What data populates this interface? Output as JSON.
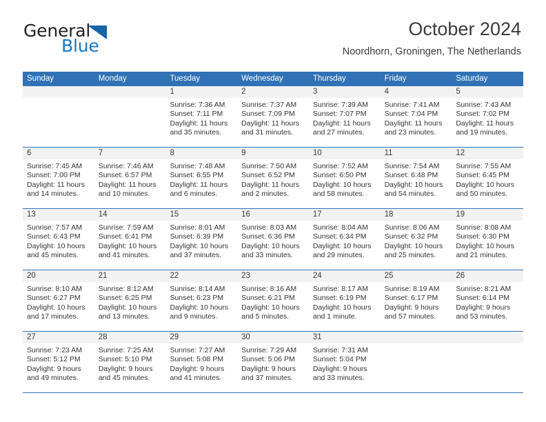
{
  "brand": {
    "line1": "General",
    "line2": "Blue",
    "triangle_color": "#1565a8",
    "blue_text_color": "#1577c4"
  },
  "header": {
    "title": "October 2024",
    "subtitle": "Noordhorn, Groningen, The Netherlands"
  },
  "colors": {
    "header_blue": "#3072b5",
    "day_number_band": "#f2f2f2",
    "text": "#333333"
  },
  "calendar": {
    "weekday_headers": [
      "Sunday",
      "Monday",
      "Tuesday",
      "Wednesday",
      "Thursday",
      "Friday",
      "Saturday"
    ],
    "weeks": [
      [
        {
          "day": "",
          "empty": true
        },
        {
          "day": "",
          "empty": true
        },
        {
          "day": "1",
          "sunrise": "Sunrise: 7:36 AM",
          "sunset": "Sunset: 7:11 PM",
          "daylight_1": "Daylight: 11 hours",
          "daylight_2": "and 35 minutes."
        },
        {
          "day": "2",
          "sunrise": "Sunrise: 7:37 AM",
          "sunset": "Sunset: 7:09 PM",
          "daylight_1": "Daylight: 11 hours",
          "daylight_2": "and 31 minutes."
        },
        {
          "day": "3",
          "sunrise": "Sunrise: 7:39 AM",
          "sunset": "Sunset: 7:07 PM",
          "daylight_1": "Daylight: 11 hours",
          "daylight_2": "and 27 minutes."
        },
        {
          "day": "4",
          "sunrise": "Sunrise: 7:41 AM",
          "sunset": "Sunset: 7:04 PM",
          "daylight_1": "Daylight: 11 hours",
          "daylight_2": "and 23 minutes."
        },
        {
          "day": "5",
          "sunrise": "Sunrise: 7:43 AM",
          "sunset": "Sunset: 7:02 PM",
          "daylight_1": "Daylight: 11 hours",
          "daylight_2": "and 19 minutes."
        }
      ],
      [
        {
          "day": "6",
          "sunrise": "Sunrise: 7:45 AM",
          "sunset": "Sunset: 7:00 PM",
          "daylight_1": "Daylight: 11 hours",
          "daylight_2": "and 14 minutes."
        },
        {
          "day": "7",
          "sunrise": "Sunrise: 7:46 AM",
          "sunset": "Sunset: 6:57 PM",
          "daylight_1": "Daylight: 11 hours",
          "daylight_2": "and 10 minutes."
        },
        {
          "day": "8",
          "sunrise": "Sunrise: 7:48 AM",
          "sunset": "Sunset: 6:55 PM",
          "daylight_1": "Daylight: 11 hours",
          "daylight_2": "and 6 minutes."
        },
        {
          "day": "9",
          "sunrise": "Sunrise: 7:50 AM",
          "sunset": "Sunset: 6:52 PM",
          "daylight_1": "Daylight: 11 hours",
          "daylight_2": "and 2 minutes."
        },
        {
          "day": "10",
          "sunrise": "Sunrise: 7:52 AM",
          "sunset": "Sunset: 6:50 PM",
          "daylight_1": "Daylight: 10 hours",
          "daylight_2": "and 58 minutes."
        },
        {
          "day": "11",
          "sunrise": "Sunrise: 7:54 AM",
          "sunset": "Sunset: 6:48 PM",
          "daylight_1": "Daylight: 10 hours",
          "daylight_2": "and 54 minutes."
        },
        {
          "day": "12",
          "sunrise": "Sunrise: 7:55 AM",
          "sunset": "Sunset: 6:45 PM",
          "daylight_1": "Daylight: 10 hours",
          "daylight_2": "and 50 minutes."
        }
      ],
      [
        {
          "day": "13",
          "sunrise": "Sunrise: 7:57 AM",
          "sunset": "Sunset: 6:43 PM",
          "daylight_1": "Daylight: 10 hours",
          "daylight_2": "and 45 minutes."
        },
        {
          "day": "14",
          "sunrise": "Sunrise: 7:59 AM",
          "sunset": "Sunset: 6:41 PM",
          "daylight_1": "Daylight: 10 hours",
          "daylight_2": "and 41 minutes."
        },
        {
          "day": "15",
          "sunrise": "Sunrise: 8:01 AM",
          "sunset": "Sunset: 6:39 PM",
          "daylight_1": "Daylight: 10 hours",
          "daylight_2": "and 37 minutes."
        },
        {
          "day": "16",
          "sunrise": "Sunrise: 8:03 AM",
          "sunset": "Sunset: 6:36 PM",
          "daylight_1": "Daylight: 10 hours",
          "daylight_2": "and 33 minutes."
        },
        {
          "day": "17",
          "sunrise": "Sunrise: 8:04 AM",
          "sunset": "Sunset: 6:34 PM",
          "daylight_1": "Daylight: 10 hours",
          "daylight_2": "and 29 minutes."
        },
        {
          "day": "18",
          "sunrise": "Sunrise: 8:06 AM",
          "sunset": "Sunset: 6:32 PM",
          "daylight_1": "Daylight: 10 hours",
          "daylight_2": "and 25 minutes."
        },
        {
          "day": "19",
          "sunrise": "Sunrise: 8:08 AM",
          "sunset": "Sunset: 6:30 PM",
          "daylight_1": "Daylight: 10 hours",
          "daylight_2": "and 21 minutes."
        }
      ],
      [
        {
          "day": "20",
          "sunrise": "Sunrise: 8:10 AM",
          "sunset": "Sunset: 6:27 PM",
          "daylight_1": "Daylight: 10 hours",
          "daylight_2": "and 17 minutes."
        },
        {
          "day": "21",
          "sunrise": "Sunrise: 8:12 AM",
          "sunset": "Sunset: 6:25 PM",
          "daylight_1": "Daylight: 10 hours",
          "daylight_2": "and 13 minutes."
        },
        {
          "day": "22",
          "sunrise": "Sunrise: 8:14 AM",
          "sunset": "Sunset: 6:23 PM",
          "daylight_1": "Daylight: 10 hours",
          "daylight_2": "and 9 minutes."
        },
        {
          "day": "23",
          "sunrise": "Sunrise: 8:16 AM",
          "sunset": "Sunset: 6:21 PM",
          "daylight_1": "Daylight: 10 hours",
          "daylight_2": "and 5 minutes."
        },
        {
          "day": "24",
          "sunrise": "Sunrise: 8:17 AM",
          "sunset": "Sunset: 6:19 PM",
          "daylight_1": "Daylight: 10 hours",
          "daylight_2": "and 1 minute."
        },
        {
          "day": "25",
          "sunrise": "Sunrise: 8:19 AM",
          "sunset": "Sunset: 6:17 PM",
          "daylight_1": "Daylight: 9 hours",
          "daylight_2": "and 57 minutes."
        },
        {
          "day": "26",
          "sunrise": "Sunrise: 8:21 AM",
          "sunset": "Sunset: 6:14 PM",
          "daylight_1": "Daylight: 9 hours",
          "daylight_2": "and 53 minutes."
        }
      ],
      [
        {
          "day": "27",
          "sunrise": "Sunrise: 7:23 AM",
          "sunset": "Sunset: 5:12 PM",
          "daylight_1": "Daylight: 9 hours",
          "daylight_2": "and 49 minutes."
        },
        {
          "day": "28",
          "sunrise": "Sunrise: 7:25 AM",
          "sunset": "Sunset: 5:10 PM",
          "daylight_1": "Daylight: 9 hours",
          "daylight_2": "and 45 minutes."
        },
        {
          "day": "29",
          "sunrise": "Sunrise: 7:27 AM",
          "sunset": "Sunset: 5:08 PM",
          "daylight_1": "Daylight: 9 hours",
          "daylight_2": "and 41 minutes."
        },
        {
          "day": "30",
          "sunrise": "Sunrise: 7:29 AM",
          "sunset": "Sunset: 5:06 PM",
          "daylight_1": "Daylight: 9 hours",
          "daylight_2": "and 37 minutes."
        },
        {
          "day": "31",
          "sunrise": "Sunrise: 7:31 AM",
          "sunset": "Sunset: 5:04 PM",
          "daylight_1": "Daylight: 9 hours",
          "daylight_2": "and 33 minutes."
        },
        {
          "day": "",
          "empty": true
        },
        {
          "day": "",
          "empty": true
        }
      ]
    ]
  }
}
